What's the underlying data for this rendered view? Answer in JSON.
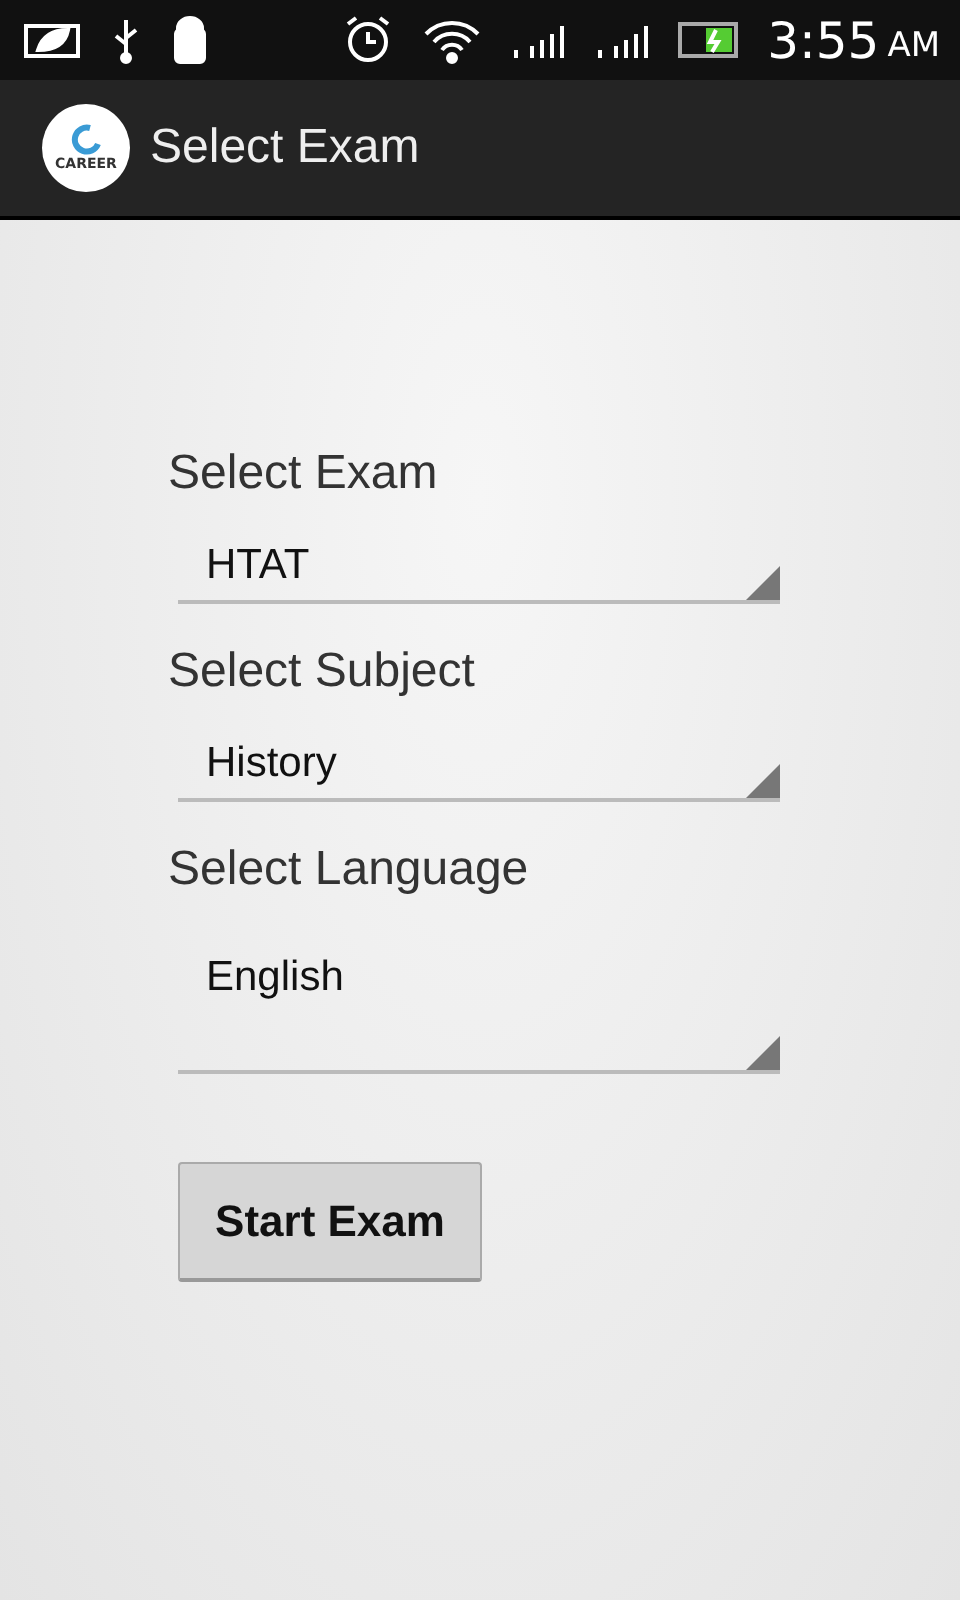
{
  "status_bar": {
    "time": "3:55",
    "meridiem": "AM"
  },
  "action_bar": {
    "logo_text": "CAREER",
    "title": "Select Exam"
  },
  "fields": [
    {
      "label": "Select Exam",
      "value": "HTAT",
      "kind": "short"
    },
    {
      "label": "Select Subject",
      "value": "History",
      "kind": "short"
    },
    {
      "label": "Select Language",
      "value": "English",
      "kind": "tall"
    }
  ],
  "button": "Start Exam"
}
